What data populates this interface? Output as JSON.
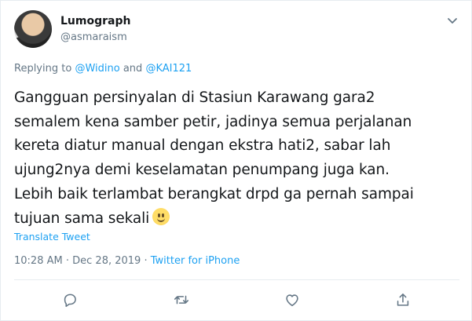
{
  "user": {
    "display_name": "Lumograph",
    "handle": "@asmaraism"
  },
  "reply": {
    "prefix": "Replying to",
    "mention_1": "@Widino",
    "conjunction": "and",
    "mention_2": "@KAI121"
  },
  "tweet": {
    "lines": [
      "Gangguan persinyalan di Stasiun Karawang gara2",
      "semalem kena samber petir, jadinya semua perjalanan",
      "kereta diatur manual dengan ekstra hati2, sabar lah",
      "ujung2nya demi keselamatan penumpang juga kan.",
      "Lebih baik terlambat berangkat drpd ga pernah sampai",
      "tujuan sama sekali"
    ],
    "emoji": "slightly-smiling-face-emoji"
  },
  "translate_label": "Translate Tweet",
  "meta": {
    "time": "10:28 AM",
    "separator_1": "·",
    "date": "Dec 28, 2019",
    "separator_2": "·",
    "client": "Twitter for iPhone"
  },
  "icons": {
    "menu": "chevron-down-icon",
    "reply": "reply-icon",
    "retweet": "retweet-icon",
    "like": "heart-icon",
    "share": "share-icon"
  },
  "colors": {
    "link": "#1da1f2",
    "secondary_text": "#657786",
    "primary_text": "#14171a",
    "border": "#e6ecf0"
  }
}
